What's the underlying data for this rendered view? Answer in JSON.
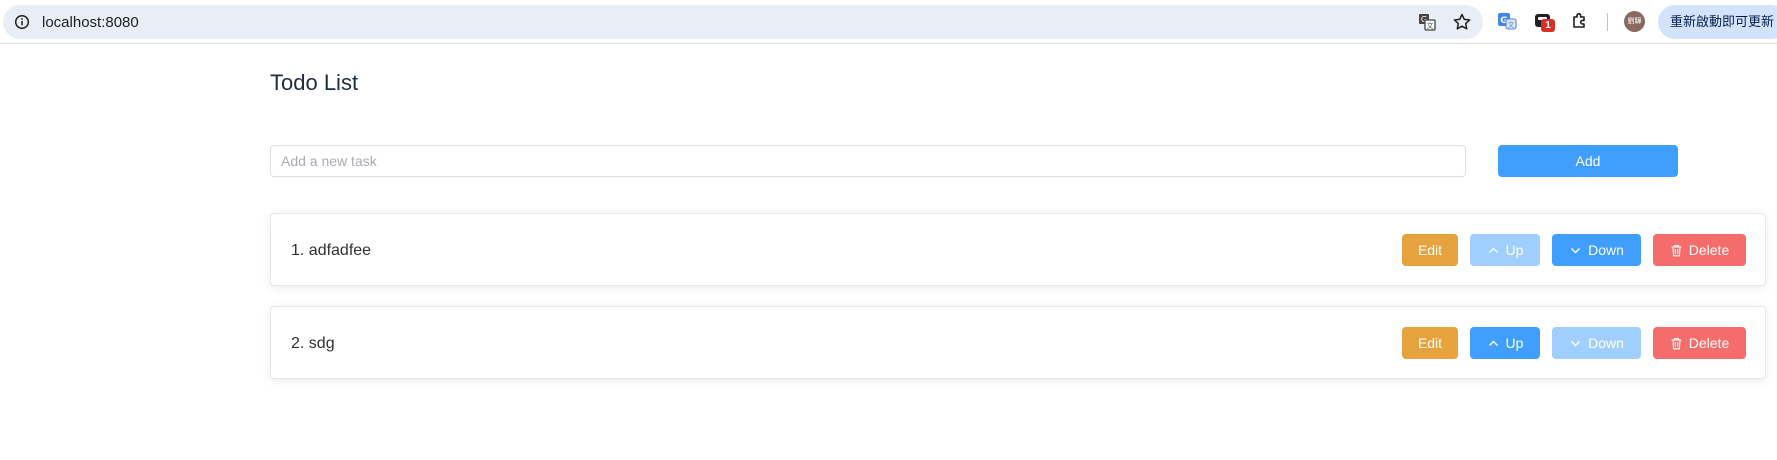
{
  "browser": {
    "url": "localhost:8080",
    "avatar_text": "劉驊",
    "extension_badge": "1",
    "restart_label": "重新啟動即可更新"
  },
  "page": {
    "title": "Todo List",
    "input_placeholder": "Add a new task",
    "input_value": "",
    "add_label": "Add"
  },
  "todos": [
    {
      "text": "1. adfadfee",
      "edit_label": "Edit",
      "up_label": "Up",
      "down_label": "Down",
      "delete_label": "Delete",
      "up_disabled": true,
      "down_disabled": false
    },
    {
      "text": "2. sdg",
      "edit_label": "Edit",
      "up_label": "Up",
      "down_label": "Down",
      "delete_label": "Delete",
      "up_disabled": false,
      "down_disabled": true
    }
  ],
  "colors": {
    "primary": "#409eff",
    "primary_disabled": "#a0cfff",
    "warning": "#e6a23c",
    "danger": "#f56c6c"
  }
}
